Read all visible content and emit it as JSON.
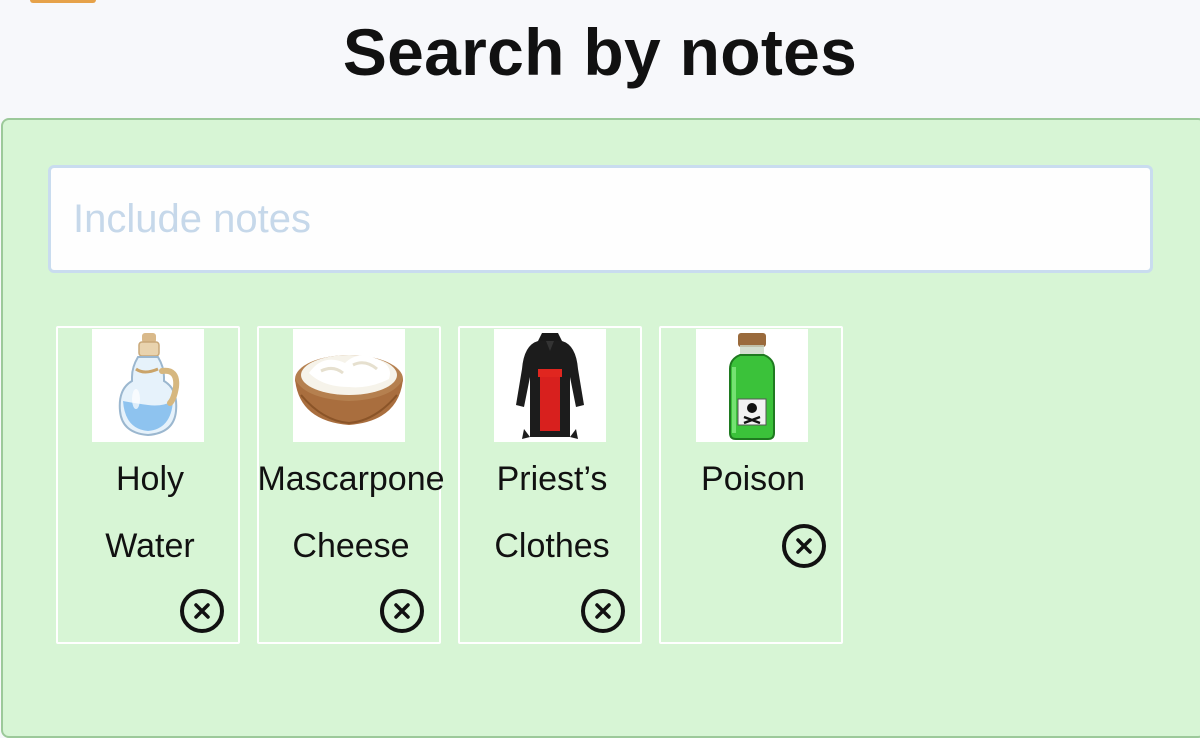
{
  "header": {
    "title": "Search by notes"
  },
  "search": {
    "placeholder": "Include notes",
    "value": ""
  },
  "notes": [
    {
      "line1": "Holy",
      "line2": "Water",
      "icon": "holy-water-bottle-icon",
      "remove_icon": "close-circle-icon"
    },
    {
      "line1": "Mascarpone",
      "line2": "Cheese",
      "icon": "mascarpone-bowl-icon",
      "remove_icon": "close-circle-icon"
    },
    {
      "line1": "Priest’s",
      "line2": "Clothes",
      "icon": "priest-robe-icon",
      "remove_icon": "close-circle-icon"
    },
    {
      "line1": "Poison",
      "line2": "",
      "icon": "poison-bottle-icon",
      "remove_icon": "close-circle-icon"
    }
  ],
  "colors": {
    "panel_bg": "#d7f5d5",
    "panel_border": "#9cc99a",
    "input_border": "#c9dcef",
    "placeholder": "#c6d8ea",
    "card_border": "#ffffff"
  }
}
